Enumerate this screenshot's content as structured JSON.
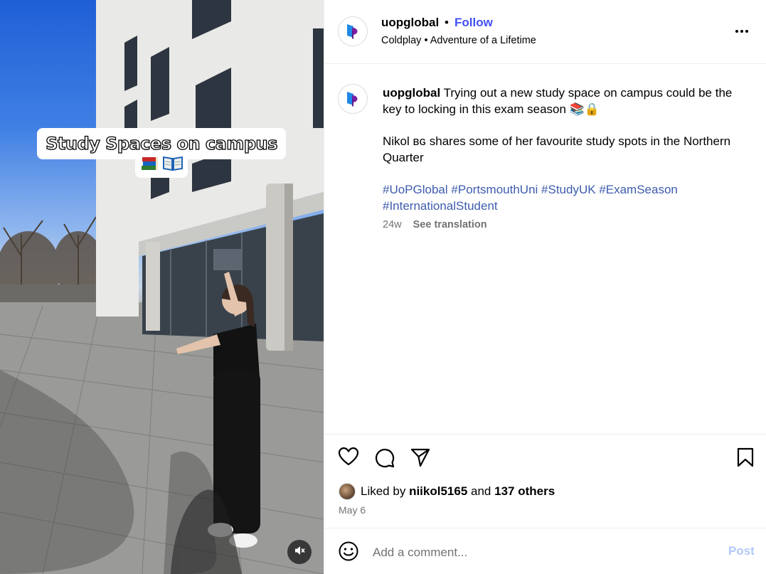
{
  "media": {
    "overlay_title": "Study Spaces on campus",
    "overlay_emoji": [
      "books-emoji",
      "open-book-emoji"
    ],
    "mute_icon": "speaker-muted-icon"
  },
  "header": {
    "username": "uopglobal",
    "separator": "•",
    "follow_label": "Follow",
    "music": "Coldplay • Adventure of a Lifetime",
    "more_icon": "more-options-icon"
  },
  "caption": {
    "username": "uopglobal",
    "line1": "Trying out a new study space on campus could be the key to locking in this exam season 📚🔒",
    "line2": "Nikol ʙɢ shares some of her favourite study spots in the Northern Quarter",
    "hashtags": [
      "#UoPGlobal",
      "#PortsmouthUni",
      "#StudyUK",
      "#ExamSeason",
      "#InternationalStudent"
    ],
    "age": "24w",
    "see_translation": "See translation"
  },
  "actions": {
    "icons": [
      "heart-icon",
      "comment-icon",
      "share-icon",
      "bookmark-icon"
    ]
  },
  "likes": {
    "prefix": "Liked by",
    "user": "niikol5165",
    "and": "and",
    "others": "137 others"
  },
  "date": "May 6",
  "comment": {
    "placeholder": "Add a comment...",
    "post_label": "Post",
    "emoji_icon": "smiley-icon"
  },
  "colors": {
    "follow": "#4150f7",
    "hashtag": "#3d5cad",
    "post_disabled": "#b2c8f7",
    "muted_text": "#737373"
  }
}
